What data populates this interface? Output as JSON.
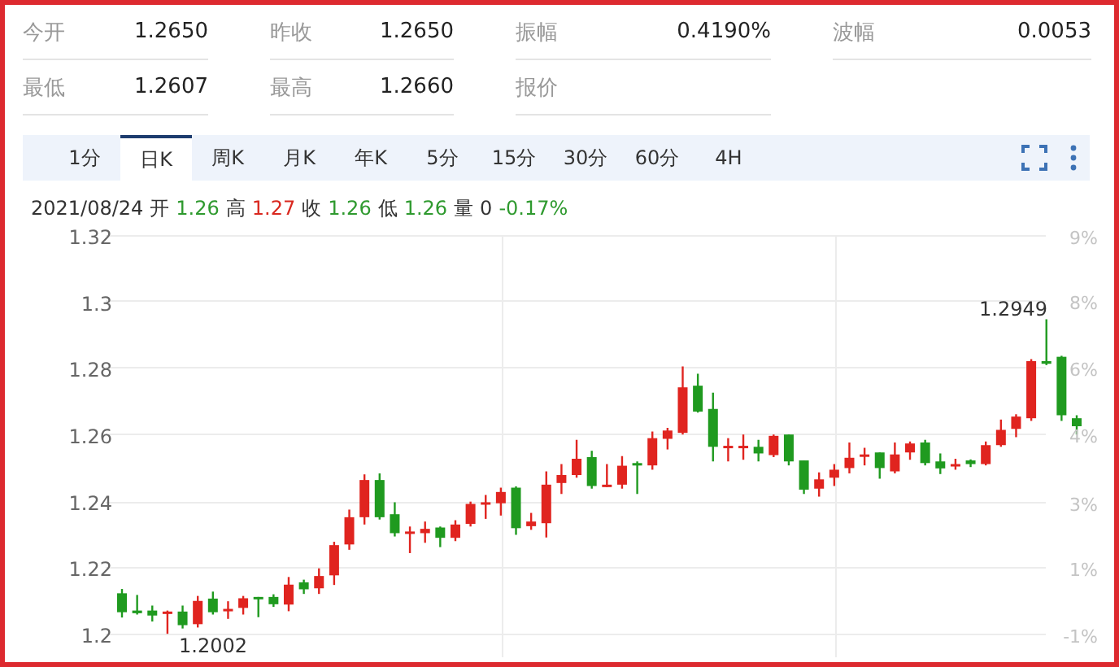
{
  "quotes": [
    {
      "label": "今开",
      "value": "1.2650"
    },
    {
      "label": "昨收",
      "value": "1.2650"
    },
    {
      "label": "振幅",
      "value": "0.4190%"
    },
    {
      "label": "波幅",
      "value": "0.0053"
    },
    {
      "label": "最低",
      "value": "1.2607"
    },
    {
      "label": "最高",
      "value": "1.2660"
    },
    {
      "label": "报价"
    }
  ],
  "tabs": [
    {
      "label": "1分",
      "selected": false
    },
    {
      "label": "日K",
      "selected": true
    },
    {
      "label": "周K",
      "selected": false
    },
    {
      "label": "月K",
      "selected": false
    },
    {
      "label": "年K",
      "selected": false
    },
    {
      "label": "5分",
      "selected": false
    },
    {
      "label": "15分",
      "selected": false
    },
    {
      "label": "30分",
      "selected": false
    },
    {
      "label": "60分",
      "selected": false
    },
    {
      "label": "4H",
      "selected": false
    }
  ],
  "info": {
    "date": "2021/08/24",
    "fields": [
      {
        "label": "开",
        "value": "1.26",
        "color": "#2f9a2f"
      },
      {
        "label": "高",
        "value": "1.27",
        "color": "#d9281f"
      },
      {
        "label": "收",
        "value": "1.26",
        "color": "#2f9a2f"
      },
      {
        "label": "低",
        "value": "1.26",
        "color": "#2f9a2f"
      },
      {
        "label": "量",
        "value": "0",
        "color": "#333333"
      },
      {
        "value": "-0.17%",
        "color": "#2f9a2f"
      }
    ]
  },
  "chart": {
    "percent_labels": [
      "9%",
      "8%",
      "6%",
      "4%",
      "3%",
      "1%",
      "-1%"
    ],
    "high_marker": "1.2949",
    "low_marker": "1.2002",
    "chart_data": {
      "type": "candlestick",
      "ylim": [
        1.2,
        1.32
      ],
      "yticks": [
        {
          "value": 1.32,
          "label": "1.32"
        },
        {
          "value": 1.3,
          "label": "1.3"
        },
        {
          "value": 1.28,
          "label": "1.28"
        },
        {
          "value": 1.26,
          "label": "1.26"
        },
        {
          "value": 1.24,
          "label": "1.24"
        },
        {
          "value": 1.22,
          "label": "1.22"
        },
        {
          "value": 1.2,
          "label": "1.2"
        }
      ],
      "grid": true,
      "ohlc": [
        [
          1.2124,
          1.2137,
          1.2051,
          1.2067
        ],
        [
          1.2072,
          1.2119,
          1.206,
          1.2064
        ],
        [
          1.2072,
          1.2087,
          1.2039,
          1.2057
        ],
        [
          1.2065,
          1.2072,
          1.2002,
          1.2069
        ],
        [
          1.2069,
          1.2087,
          1.2018,
          1.2028
        ],
        [
          1.2031,
          1.2116,
          1.2021,
          1.2101
        ],
        [
          1.2108,
          1.2129,
          1.206,
          1.2067
        ],
        [
          1.207,
          1.21,
          1.2047,
          1.2077
        ],
        [
          1.208,
          1.2116,
          1.206,
          1.2109
        ],
        [
          1.2113,
          1.2113,
          1.2052,
          1.2108
        ],
        [
          1.2113,
          1.2121,
          1.2083,
          1.2091
        ],
        [
          1.209,
          1.2173,
          1.207,
          1.215
        ],
        [
          1.2157,
          1.2165,
          1.2122,
          1.2136
        ],
        [
          1.2139,
          1.2199,
          1.2122,
          1.2176
        ],
        [
          1.2178,
          1.2279,
          1.2149,
          1.2269
        ],
        [
          1.2271,
          1.2376,
          1.2255,
          1.2353
        ],
        [
          1.2353,
          1.2482,
          1.2331,
          1.2465
        ],
        [
          1.2465,
          1.2485,
          1.2346,
          1.2353
        ],
        [
          1.2362,
          1.2398,
          1.2295,
          1.2305
        ],
        [
          1.2304,
          1.2325,
          1.2245,
          1.231
        ],
        [
          1.2305,
          1.234,
          1.2276,
          1.2318
        ],
        [
          1.2322,
          1.2325,
          1.2263,
          1.2291
        ],
        [
          1.2291,
          1.2344,
          1.2281,
          1.2331
        ],
        [
          1.2333,
          1.24,
          1.2325,
          1.2393
        ],
        [
          1.2393,
          1.242,
          1.2348,
          1.2398
        ],
        [
          1.2395,
          1.2442,
          1.2358,
          1.2429
        ],
        [
          1.2442,
          1.2446,
          1.23,
          1.232
        ],
        [
          1.2326,
          1.2366,
          1.2315,
          1.234
        ],
        [
          1.2335,
          1.2491,
          1.2292,
          1.2451
        ],
        [
          1.2456,
          1.2513,
          1.2423,
          1.248
        ],
        [
          1.248,
          1.2586,
          1.2472,
          1.2529
        ],
        [
          1.2534,
          1.2553,
          1.2439,
          1.2447
        ],
        [
          1.2446,
          1.2513,
          1.2444,
          1.2451
        ],
        [
          1.2451,
          1.2537,
          1.2439,
          1.2508
        ],
        [
          1.2516,
          1.2521,
          1.2423,
          1.2513
        ],
        [
          1.2509,
          1.2611,
          1.2496,
          1.2591
        ],
        [
          1.2589,
          1.2622,
          1.2557,
          1.2614
        ],
        [
          1.2607,
          1.2807,
          1.2602,
          1.2744
        ],
        [
          1.2749,
          1.2785,
          1.2668,
          1.2671
        ],
        [
          1.2679,
          1.2728,
          1.2521,
          1.2565
        ],
        [
          1.2563,
          1.2591,
          1.2521,
          1.2568
        ],
        [
          1.2563,
          1.2602,
          1.2526,
          1.2568
        ],
        [
          1.2565,
          1.2586,
          1.2521,
          1.2545
        ],
        [
          1.254,
          1.2602,
          1.2534,
          1.2598
        ],
        [
          1.2602,
          1.2602,
          1.2509,
          1.2521
        ],
        [
          1.2524,
          1.2524,
          1.2423,
          1.2436
        ],
        [
          1.2439,
          1.2488,
          1.2415,
          1.2467
        ],
        [
          1.2472,
          1.2513,
          1.2447,
          1.2496
        ],
        [
          1.2501,
          1.2578,
          1.2485,
          1.2532
        ],
        [
          1.2537,
          1.2562,
          1.2509,
          1.2542
        ],
        [
          1.2548,
          1.2548,
          1.2469,
          1.2501
        ],
        [
          1.2491,
          1.2578,
          1.2485,
          1.2542
        ],
        [
          1.2548,
          1.2581,
          1.2526,
          1.2575
        ],
        [
          1.2578,
          1.2586,
          1.2509,
          1.2516
        ],
        [
          1.2521,
          1.2545,
          1.2483,
          1.25
        ],
        [
          1.2506,
          1.2529,
          1.2496,
          1.2513
        ],
        [
          1.2524,
          1.2527,
          1.2504,
          1.2513
        ],
        [
          1.2513,
          1.2581,
          1.2509,
          1.257
        ],
        [
          1.257,
          1.2647,
          1.2565,
          1.2616
        ],
        [
          1.2619,
          1.2663,
          1.2594,
          1.2656
        ],
        [
          1.2651,
          1.2829,
          1.2643,
          1.2823
        ],
        [
          1.2823,
          1.2949,
          1.2811,
          1.2815
        ],
        [
          1.2836,
          1.2839,
          1.2643,
          1.266
        ],
        [
          1.2651,
          1.266,
          1.2602,
          1.2627
        ]
      ]
    }
  }
}
